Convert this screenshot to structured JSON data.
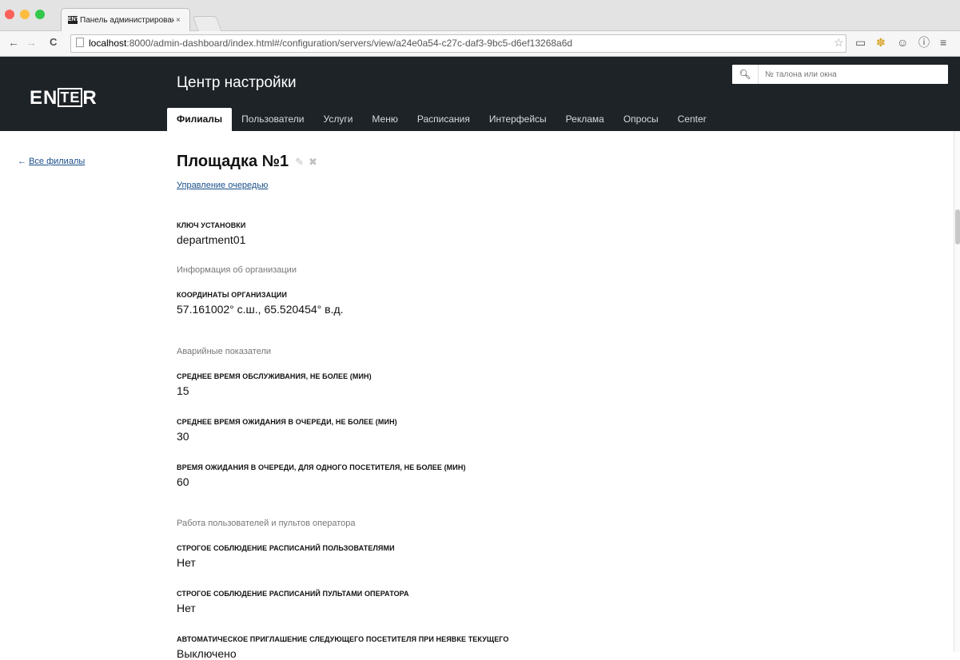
{
  "browser": {
    "tab_title": "Панель администрирован",
    "tab_close": "×",
    "favicon_text": "ENT",
    "url_host": "localhost",
    "url_rest": ":8000/admin-dashboard/index.html#/configuration/servers/view/a24e0a54-c27c-daf3-9bc5-d6ef13268a6d",
    "traffic_colors": [
      "#fc605c",
      "#fdbc40",
      "#34c84a"
    ]
  },
  "header": {
    "logo": "ENTER",
    "title": "Центр настройки",
    "search_placeholder": "№ талона или окна",
    "tabs": [
      {
        "label": "Филиалы",
        "active": true
      },
      {
        "label": "Пользователи"
      },
      {
        "label": "Услуги"
      },
      {
        "label": "Меню"
      },
      {
        "label": "Расписания"
      },
      {
        "label": "Интерфейсы"
      },
      {
        "label": "Реклама"
      },
      {
        "label": "Опросы"
      },
      {
        "label": "Center"
      }
    ]
  },
  "sidebar": {
    "back_arrow": "←",
    "back_label": "Все филиалы"
  },
  "page": {
    "title": "Площадка №1",
    "queue_link": "Управление очередью",
    "install_key_label": "Ключ установки",
    "install_key_value": "department01",
    "section_org": "Информация об организации",
    "coords_label": "Координаты организации",
    "coords_value": "57.161002° с.ш., 65.520454° в.д.",
    "section_alarm": "Аварийные показатели",
    "avg_service_label": "Среднее время обслуживания, не более (мин)",
    "avg_service_value": "15",
    "avg_wait_label": "Среднее время ожидания в очереди, не более (мин)",
    "avg_wait_value": "30",
    "single_wait_label": "Время ожидания в очереди, для одного посетителя, не более (мин)",
    "single_wait_value": "60",
    "section_users": "Работа пользователей и пультов оператора",
    "strict_users_label": "Строгое соблюдение расписаний пользователями",
    "strict_users_value": "Нет",
    "strict_consoles_label": "Строгое соблюдение расписаний пультами оператора",
    "strict_consoles_value": "Нет",
    "auto_invite_label": "Автоматическое приглашение следующего посетителя при неявке текущего",
    "auto_invite_value": "Выключено"
  },
  "colors": {
    "header_bg": "#1e2328",
    "link": "#1b4f8a"
  }
}
